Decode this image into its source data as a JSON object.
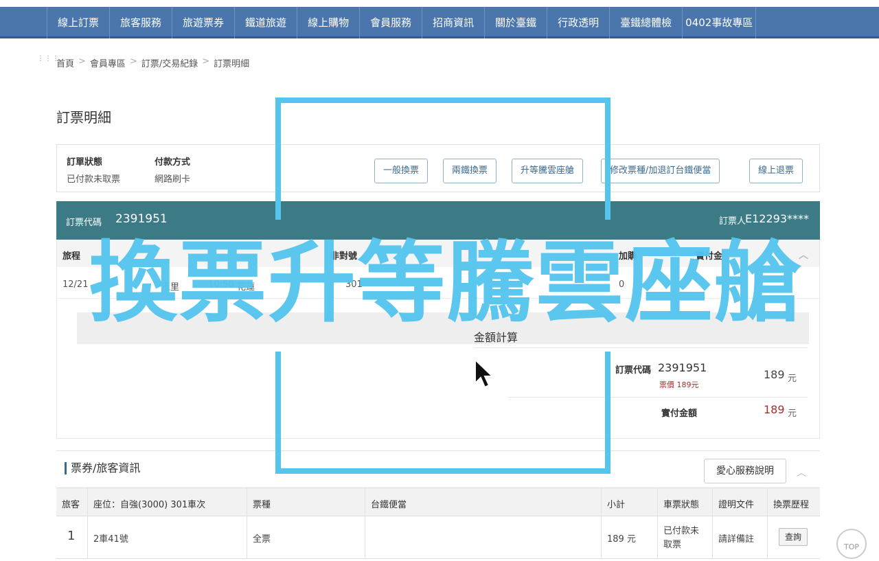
{
  "nav": {
    "items": [
      "線上訂票",
      "旅客服務",
      "旅遊票券",
      "鐵道旅遊",
      "線上購物",
      "會員服務",
      "招商資訊",
      "關於臺鐵",
      "行政透明",
      "臺鐵總體檢",
      "0402事故專區"
    ]
  },
  "breadcrumb": [
    "首頁",
    "會員專區",
    "訂票/交易紀錄",
    "訂票明細"
  ],
  "page_title": "訂票明細",
  "status": {
    "order_status_label": "訂單狀態",
    "order_status_value": "已付款未取票",
    "payment_label": "付款方式",
    "payment_value": "網路刷卡"
  },
  "actions": [
    "一般換票",
    "兩鐵換票",
    "升等騰雲座艙",
    "修改票種/加退訂台鐵便當",
    "線上退票"
  ],
  "booking": {
    "code_label": "訂票代碼",
    "code_value": "2391951",
    "booker_label": "訂票人",
    "booker_value": "E12293****"
  },
  "trip": {
    "headers": [
      "旅程",
      "非對號",
      "加購",
      "實付金"
    ],
    "row": [
      "12/21",
      "玉里",
      "10:50",
      "花蓮",
      "301",
      "0"
    ]
  },
  "amount": {
    "title": "金額計算",
    "code_label": "訂票代碼",
    "code_value": "2391951",
    "fare_text": "票價 189元",
    "fare_value": "189",
    "paid_label": "實付金額",
    "paid_value": "189",
    "unit": "元"
  },
  "passenger": {
    "title": "票券/旅客資訊",
    "love_button": "愛心服務說明",
    "headers": [
      "旅客",
      "座位：自強(3000) 301車次",
      "票種",
      "台鐵便當",
      "小計",
      "車票狀態",
      "證明文件",
      "換票歷程"
    ],
    "row": {
      "index": "1",
      "seat": "2車41號",
      "ticket_type": "全票",
      "bento": "",
      "subtotal": "189 元",
      "ticket_status": "已付款未取票",
      "document": "請詳備註",
      "query_button": "查詢"
    }
  },
  "top_button": "TOP",
  "overlay": {
    "text": "換票升等騰雲座艙",
    "color": "#55c5ee"
  },
  "colors": {
    "nav": "#4a76ad",
    "booking_bar": "#3c7a85",
    "price_red": "#a0302f"
  }
}
